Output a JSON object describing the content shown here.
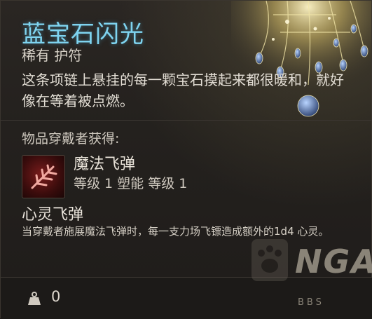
{
  "item": {
    "title": "蓝宝石闪光",
    "subtitle": "稀有 护符",
    "description": "这条项链上悬挂的每一颗宝石摸起来都很暖和，就好像在等着被点燃。"
  },
  "grants": {
    "label": "物品穿戴者获得:",
    "spell": {
      "icon": "magic-missile-icon",
      "name": "魔法飞弹",
      "level": "等级 1  塑能  等级 1"
    },
    "ability": {
      "name": "心灵飞弹",
      "description": "当穿戴者施展魔法飞弹时，每一支力场飞镖造成额外的1d4 心灵。"
    }
  },
  "footer": {
    "weight_icon": "weight-icon",
    "weight_value": "0"
  },
  "watermark": {
    "logo": "NGA",
    "sub": "BBS"
  },
  "colors": {
    "title": "#7fd4f0",
    "background": "#24211e"
  }
}
